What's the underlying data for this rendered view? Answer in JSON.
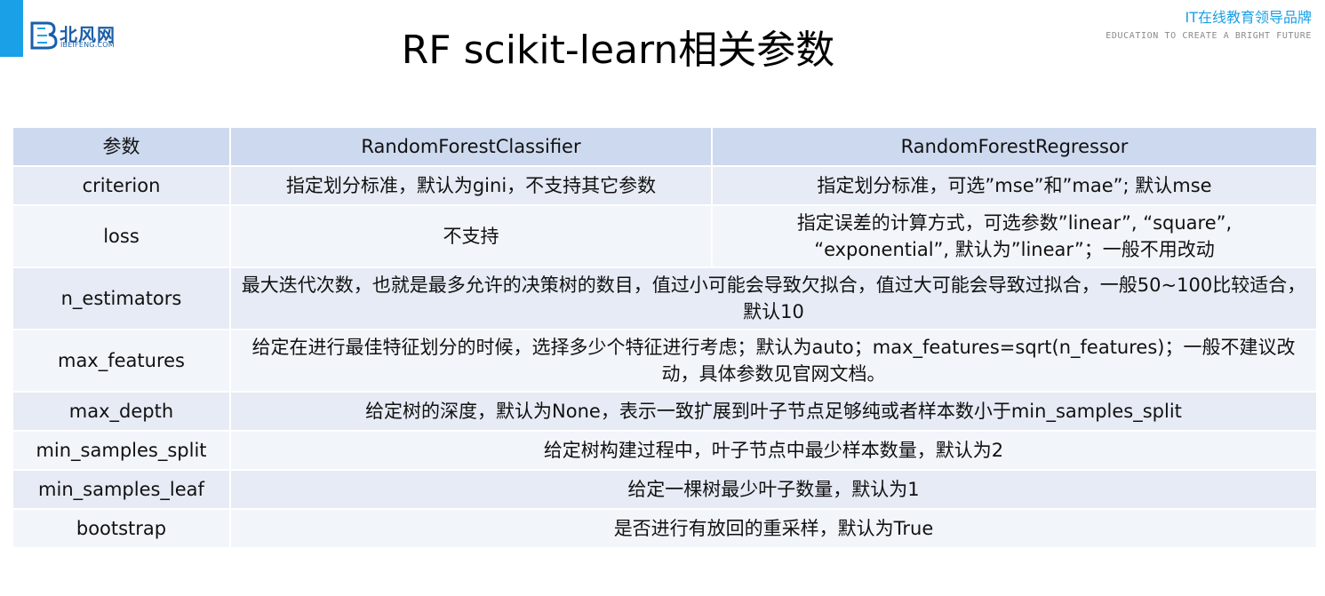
{
  "header": {
    "title": "RF scikit-learn相关参数",
    "logo_name": "北风网",
    "logo_domain": "IBEIFENG.COM",
    "brand_cn": "IT在线教育领导品牌",
    "brand_en": "EDUCATION TO CREATE A BRIGHT FUTURE"
  },
  "table": {
    "headers": [
      "参数",
      "RandomForestClassifier",
      "RandomForestRegressor"
    ],
    "rows": [
      {
        "param": "criterion",
        "classifier": "指定划分标准，默认为gini，不支持其它参数",
        "regressor": "指定划分标准，可选”mse”和”mae”; 默认mse"
      },
      {
        "param": "loss",
        "classifier": "不支持",
        "regressor": "指定误差的计算方式，可选参数”linear”, “square”, “exponential”, 默认为”linear”；一般不用改动"
      },
      {
        "param": "n_estimators",
        "both": "最大迭代次数，也就是最多允许的决策树的数目，值过小可能会导致欠拟合，值过大可能会导致过拟合，一般50~100比较适合，默认10"
      },
      {
        "param": "max_features",
        "both": "给定在进行最佳特征划分的时候，选择多少个特征进行考虑；默认为auto；max_features=sqrt(n_features)；一般不建议改动，具体参数见官网文档。"
      },
      {
        "param": "max_depth",
        "both": "给定树的深度，默认为None，表示一致扩展到叶子节点足够纯或者样本数小于min_samples_split"
      },
      {
        "param": "min_samples_split",
        "both": "给定树构建过程中，叶子节点中最少样本数量，默认为2"
      },
      {
        "param": "min_samples_leaf",
        "both": "给定一棵树最少叶子数量，默认为1"
      },
      {
        "param": "bootstrap",
        "both": "是否进行有放回的重采样，默认为True"
      }
    ]
  },
  "colors": {
    "accent": "#1aa0e6",
    "header_row": "#cdd9ee",
    "row_dark": "#e6ebf5",
    "row_light": "#f2f5fa"
  }
}
